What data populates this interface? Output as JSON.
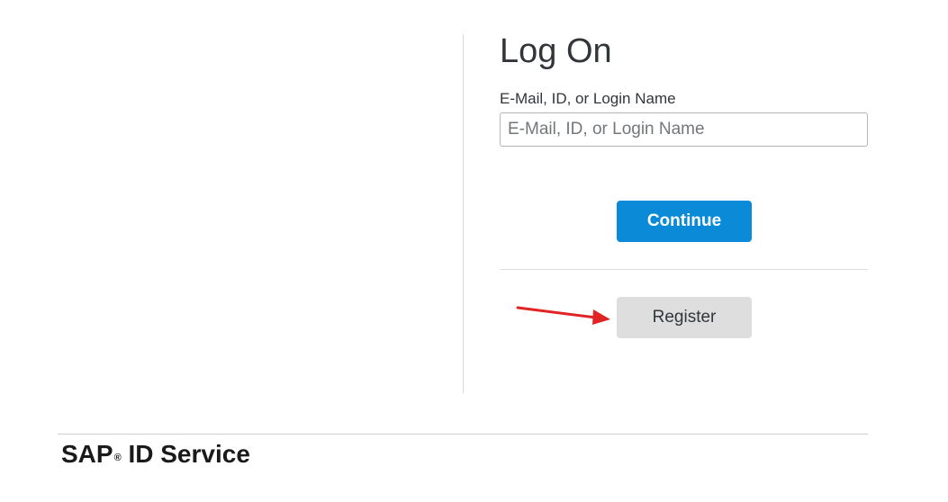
{
  "page": {
    "title": "Log On"
  },
  "login": {
    "label": "E-Mail, ID, or Login Name",
    "placeholder": "E-Mail, ID, or Login Name",
    "value": ""
  },
  "actions": {
    "continue_label": "Continue",
    "register_label": "Register"
  },
  "footer": {
    "brand_prefix": "SAP",
    "brand_mark": "®",
    "brand_suffix": " ID Service"
  },
  "colors": {
    "primary": "#0a8ad7",
    "secondary": "#dedede",
    "annotation": "#e02424"
  },
  "icons": {
    "annotation": "arrow-right-icon"
  }
}
